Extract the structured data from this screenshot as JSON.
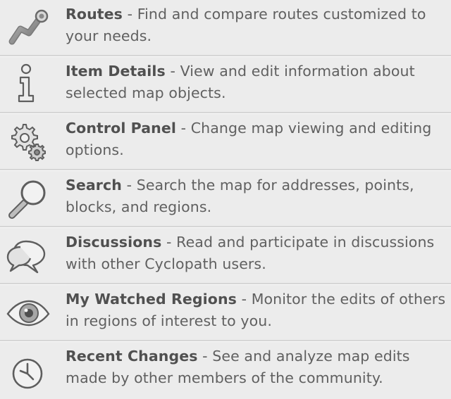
{
  "items": [
    {
      "icon": "routes-icon",
      "title": "Routes",
      "sep": " - ",
      "desc": "Find and compare routes customized to your needs."
    },
    {
      "icon": "info-icon",
      "title": "Item Details",
      "sep": " - ",
      "desc": "View and edit information about selected map objects."
    },
    {
      "icon": "gears-icon",
      "title": "Control Panel",
      "sep": " - ",
      "desc": "Change map viewing and editing options."
    },
    {
      "icon": "magnifier-icon",
      "title": "Search",
      "sep": " - ",
      "desc": "Search the map for addresses, points, blocks, and regions."
    },
    {
      "icon": "speech-bubbles-icon",
      "title": "Discussions",
      "sep": " - ",
      "desc": "Read and participate in discussions with other Cyclopath users."
    },
    {
      "icon": "eye-icon",
      "title": "My Watched Regions",
      "sep": " - ",
      "desc": "Monitor the edits of others in regions of interest to you."
    },
    {
      "icon": "clock-icon",
      "title": "Recent Changes",
      "sep": " - ",
      "desc": "See and analyze map edits made by other members of the community."
    }
  ]
}
